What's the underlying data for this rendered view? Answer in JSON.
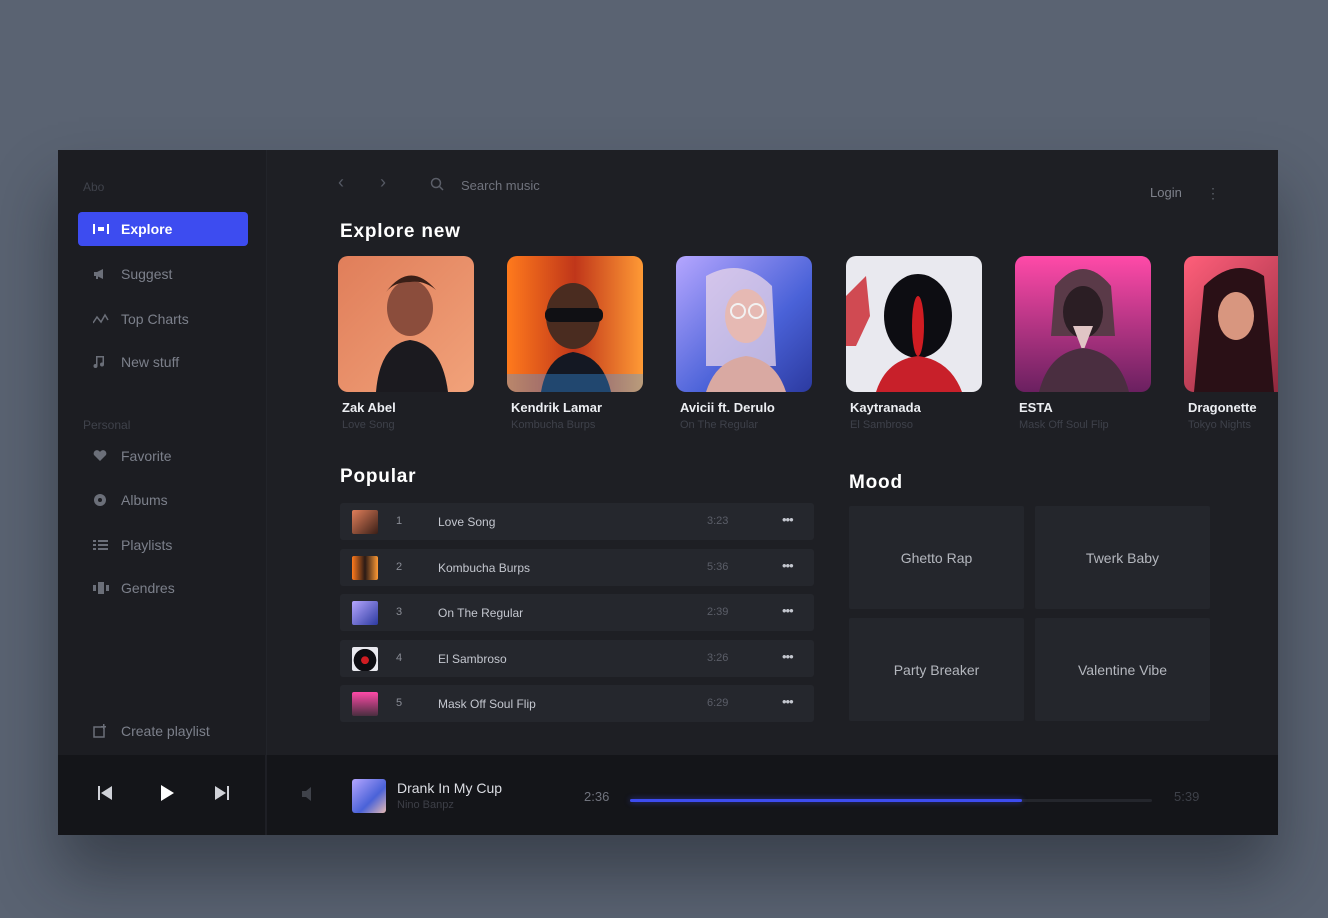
{
  "app": {
    "title": "Abo"
  },
  "colors": {
    "accent": "#3d4cf0",
    "background": "#1e1f24",
    "panel": "#25272d"
  },
  "sidebar": {
    "items": [
      {
        "label": "Explore",
        "icon": "explore-icon",
        "active": true
      },
      {
        "label": "Suggest",
        "icon": "megaphone-icon"
      },
      {
        "label": "Top Charts",
        "icon": "chart-icon"
      },
      {
        "label": "New stuff",
        "icon": "music-note-icon"
      }
    ],
    "personal_label": "Personal",
    "personal_items": [
      {
        "label": "Favorite",
        "icon": "heart-icon"
      },
      {
        "label": "Albums",
        "icon": "disc-icon"
      },
      {
        "label": "Playlists",
        "icon": "list-icon"
      },
      {
        "label": "Gendres",
        "icon": "genres-icon"
      }
    ],
    "create_playlist": "Create playlist"
  },
  "topbar": {
    "search_placeholder": "Search music",
    "login": "Login"
  },
  "explore": {
    "title": "Explore new",
    "artists": [
      {
        "name": "Zak Abel",
        "song": "Love Song"
      },
      {
        "name": "Kendrik Lamar",
        "song": "Kombucha Burps"
      },
      {
        "name": "Avicii ft. Derulo",
        "song": "On The Regular"
      },
      {
        "name": "Kaytranada",
        "song": "El Sambroso"
      },
      {
        "name": "ESTA",
        "song": "Mask Off Soul Flip"
      },
      {
        "name": "Dragonette",
        "song": "Tokyo Nights"
      }
    ]
  },
  "popular": {
    "title": "Popular",
    "tracks": [
      {
        "num": "1",
        "title": "Love Song",
        "duration": "3:23"
      },
      {
        "num": "2",
        "title": "Kombucha Burps",
        "duration": "5:36"
      },
      {
        "num": "3",
        "title": "On The Regular",
        "duration": "2:39"
      },
      {
        "num": "4",
        "title": "El Sambroso",
        "duration": "3:26"
      },
      {
        "num": "5",
        "title": "Mask Off Soul Flip",
        "duration": "6:29"
      }
    ]
  },
  "mood": {
    "title": "Mood",
    "items": [
      "Ghetto Rap",
      "Twerk Baby",
      "Party Breaker",
      "Valentine Vibe"
    ]
  },
  "player": {
    "title": "Drank In My Cup",
    "artist": "Nino Banpz",
    "current": "2:36",
    "total": "5:39",
    "progress": 0.75
  }
}
